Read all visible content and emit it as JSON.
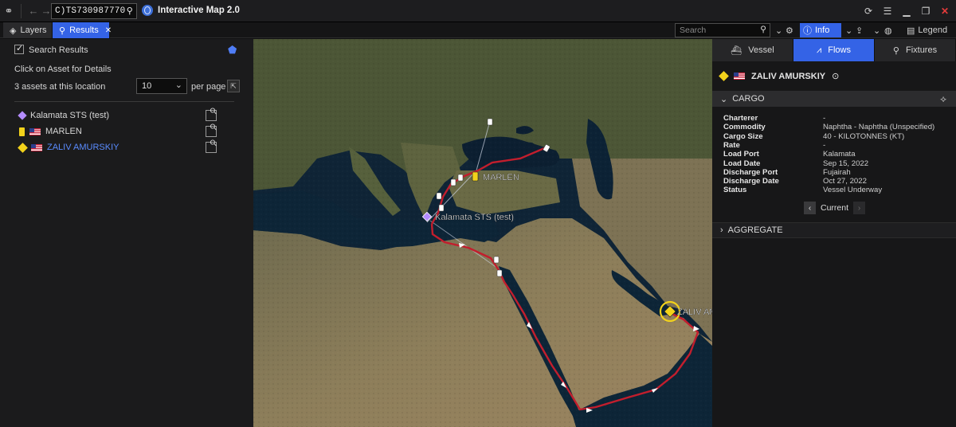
{
  "titlebar": {
    "ticker": "C)TS730987770)",
    "app_title": "Interactive Map 2.0"
  },
  "toolbar": {
    "layers_label": "Layers",
    "results_label": "Results",
    "search_placeholder": "Search",
    "info_label": "Info",
    "legend_label": "Legend"
  },
  "left": {
    "search_results_label": "Search Results",
    "hint": "Click on Asset for Details",
    "count_text": "3 assets at this location",
    "per_page_value": "10",
    "per_page_label": "per page",
    "assets": [
      {
        "name": "Kalamata STS (test)",
        "icon": "purple-diamond-icon",
        "flag": ""
      },
      {
        "name": "MARLEN",
        "icon": "yellow-ship-icon",
        "flag": "us-flag"
      },
      {
        "name": "ZALIV AMURSKIY",
        "icon": "yellow-diamond-ship-icon",
        "flag": "us-flag"
      }
    ]
  },
  "map": {
    "labels": {
      "marlen": "MARLEN",
      "kalamata": "Kalamata STS (test)",
      "zaliv": "ZALIV AMURSKIY"
    }
  },
  "right": {
    "tabs": [
      "Vessel",
      "Flows",
      "Fixtures"
    ],
    "vessel_name": "ZALIV AMURSKIY",
    "cargo_title": "CARGO",
    "cargo": [
      {
        "k": "Charterer",
        "v": "-"
      },
      {
        "k": "Commodity",
        "v": "Naphtha - Naphtha (Unspecified)"
      },
      {
        "k": "Cargo Size",
        "v": "40 - KILOTONNES (KT)"
      },
      {
        "k": "Rate",
        "v": "-"
      },
      {
        "k": "Load Port",
        "v": "Kalamata"
      },
      {
        "k": "Load Date",
        "v": "Sep 15, 2022"
      },
      {
        "k": "Discharge Port",
        "v": "Fujairah"
      },
      {
        "k": "Discharge Date",
        "v": "Oct 27, 2022"
      },
      {
        "k": "Status",
        "v": "Vessel Underway"
      }
    ],
    "pager_label": "Current",
    "aggregate_title": "AGGREGATE"
  },
  "colors": {
    "accent": "#3463e6",
    "route": "#c21e2d",
    "vessel_yellow": "#f2d21b",
    "sts_purple": "#b48cff"
  }
}
